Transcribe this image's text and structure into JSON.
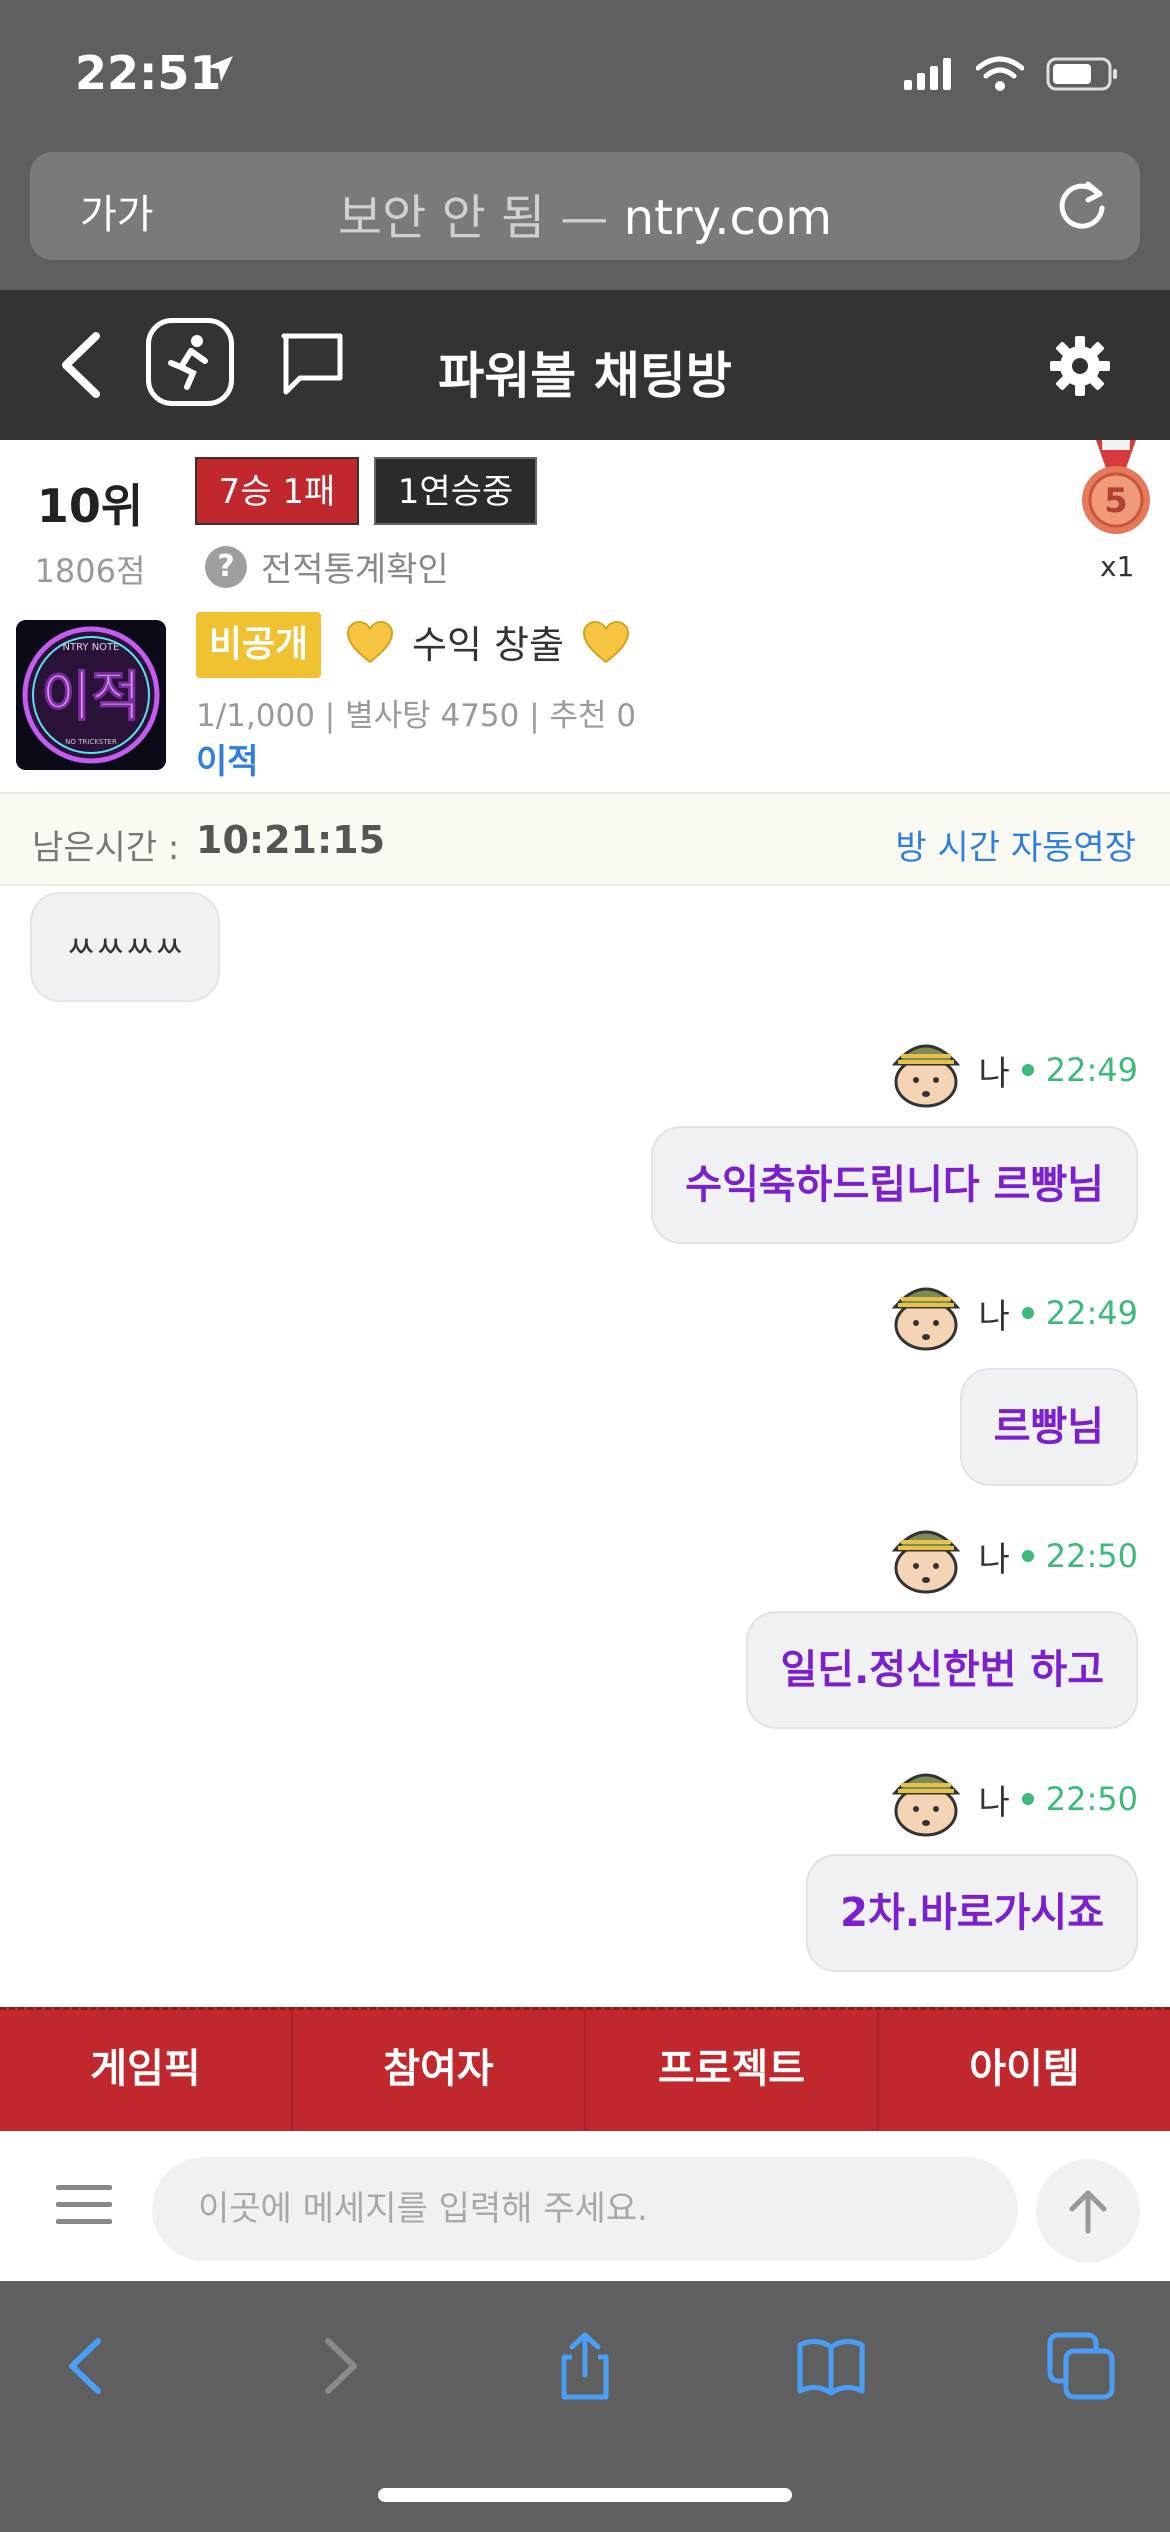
{
  "status_bar": {
    "time": "22:51"
  },
  "browser": {
    "aa_label": "가가",
    "url_prefix": "보안 안 됨 — ",
    "url_domain": "ntry.com"
  },
  "header": {
    "title": "파워볼 채팅방"
  },
  "profile": {
    "rank": "10위",
    "score": "1806점",
    "record": "7승 1패",
    "streak": "1연승중",
    "stats_link": "전적통계확인",
    "medal_count": "x1",
    "medal_number": "5"
  },
  "room": {
    "badge": "비공개",
    "title": "수익 창출",
    "meta": "1/1,000 | 별사탕 4750 | 추천 0",
    "owner": "이적",
    "avatar_text": "이적",
    "avatar_top_text": "NTRY NOTE",
    "avatar_bottom_text": "NO TRICKSTER"
  },
  "timer": {
    "label": "남은시간 :",
    "value": "10:21:15",
    "extend": "방 시간 자동연장"
  },
  "messages": [
    {
      "side": "left",
      "text": "ㅆㅆㅆㅆ"
    },
    {
      "side": "right",
      "name": "나",
      "time": "22:49",
      "text": "수익축하드립니다 르빵님"
    },
    {
      "side": "right",
      "name": "나",
      "time": "22:49",
      "text": "르빵님"
    },
    {
      "side": "right",
      "name": "나",
      "time": "22:50",
      "text": "일딘.정신한번 하고"
    },
    {
      "side": "right",
      "name": "나",
      "time": "22:50",
      "text": "2차.바로가시죠"
    }
  ],
  "tabs": [
    "게임픽",
    "참여자",
    "프로젝트",
    "아이템"
  ],
  "input": {
    "placeholder": "이곳에 메세지를 입력해 주세요."
  },
  "colors": {
    "accent_red": "#c0282d",
    "header_dark": "#333333",
    "link_blue": "#2f7fe0",
    "message_purple": "#7c1fcf",
    "online_green": "#3cba7a"
  }
}
